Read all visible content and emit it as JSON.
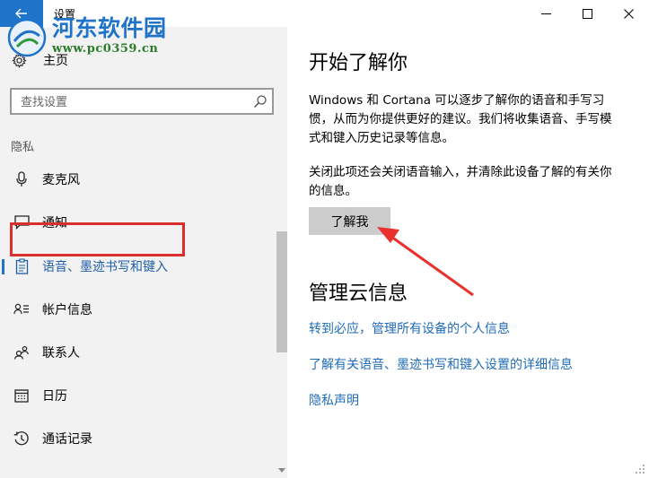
{
  "window": {
    "title": "设置",
    "back_icon": "arrow-left-icon",
    "controls": [
      "minimize-icon",
      "maximize-icon",
      "close-icon"
    ],
    "accent_color": "#1f73c9"
  },
  "watermark": {
    "title": "河东软件园",
    "url": "www.pc0359.cn"
  },
  "sidebar": {
    "home": {
      "label": "主页",
      "icon": "gear-icon"
    },
    "search": {
      "placeholder": "查找设置",
      "icon": "search-icon"
    },
    "section_label": "隐私",
    "items": [
      {
        "label": "麦克风",
        "icon": "microphone-icon",
        "selected": false
      },
      {
        "label": "通知",
        "icon": "notification-icon",
        "selected": false
      },
      {
        "label": "语音、墨迹书写和键入",
        "icon": "clipboard-icon",
        "selected": true
      },
      {
        "label": "帐户信息",
        "icon": "account-info-icon",
        "selected": false
      },
      {
        "label": "联系人",
        "icon": "contacts-icon",
        "selected": false
      },
      {
        "label": "日历",
        "icon": "calendar-icon",
        "selected": false
      },
      {
        "label": "通话记录",
        "icon": "call-history-icon",
        "selected": false
      }
    ]
  },
  "main": {
    "heading": "开始了解你",
    "paragraph1": "Windows 和 Cortana 可以逐步了解你的语音和手写习惯，从而为你提供更好的建议。我们将收集语音、手写模式和键入历史记录等信息。",
    "paragraph2": "关闭此项还会关闭语音输入，并清除此设备了解的有关你的信息。",
    "button_label": "了解我",
    "cloud_heading": "管理云信息",
    "links": [
      "转到必应，管理所有设备的个人信息",
      "了解有关语音、墨迹书写和键入设置的详细信息",
      "隐私声明"
    ]
  },
  "annotations": {
    "highlight_color": "#d9302d"
  }
}
